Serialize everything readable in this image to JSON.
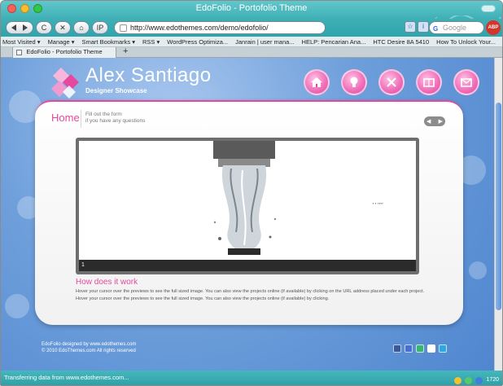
{
  "window": {
    "title": "EdoFolio - Portofolio Theme"
  },
  "toolbar": {
    "back_icon": "back-arrow-icon",
    "forward_icon": "forward-arrow-icon",
    "reload_label": "C",
    "stop_label": "✕",
    "home_label": "⌂",
    "ip_label": "IP",
    "url": "http://www.edothemes.com/demo/edofolio/",
    "search_placeholder": "Google"
  },
  "bookmarks": [
    "Most Visited ▾",
    "Manage ▾",
    "Smart Bookmarks ▾",
    "RSS ▾",
    "WordPress Optimiza...",
    "Janrain | user mana...",
    "HELP: Pencarian Ana...",
    "HTC Desire 8A 5410",
    "How To Unlock Your..."
  ],
  "tabs": [
    {
      "label": "EdoFolio - Portofolio Theme"
    }
  ],
  "new_tab_label": "+",
  "site": {
    "brand_name": "Alex Santiago",
    "brand_sub": "Designer Showcase",
    "nav_icons": [
      "home-icon",
      "lightbulb-icon",
      "tools-icon",
      "portfolio-icon",
      "mail-icon"
    ],
    "accent": "#e7489f"
  },
  "panel": {
    "title": "Home",
    "subtitle_line1": "Fill out the form",
    "subtitle_line2": "if you have any questions",
    "slide_number": "1",
    "howto_title": "How does it work",
    "howto_text": "Hover your cursor over the previews to see the full sized image. You can also view the projects online (if available) by clicking on the URL address placed under each project. Hover your cursor over the previews to see the full sized image. You can also view the projects online (if available) by clicking."
  },
  "footer": {
    "line1": "EdoFolio designed by www.edothemes.com",
    "line2": "© 2010 EdoThemes.com All rights reserved"
  },
  "status": {
    "text": "Transferring data from www.edothemes.com...",
    "counter": "1720"
  }
}
